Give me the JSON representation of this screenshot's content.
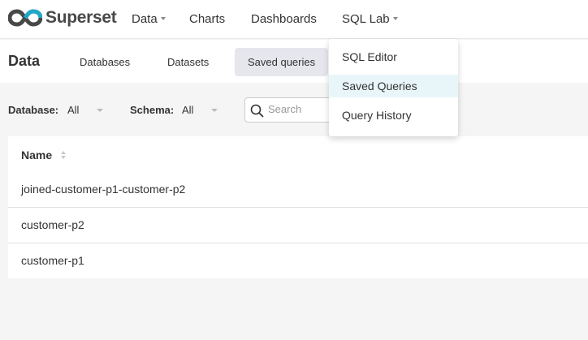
{
  "app": {
    "name": "Superset",
    "brand_colors": {
      "dark": "#484848",
      "teal": "#20a7c9"
    }
  },
  "navbar": {
    "items": [
      {
        "label": "Data",
        "has_caret": true
      },
      {
        "label": "Charts",
        "has_caret": false
      },
      {
        "label": "Dashboards",
        "has_caret": false
      },
      {
        "label": "SQL Lab",
        "has_caret": true
      }
    ]
  },
  "subheader": {
    "title": "Data",
    "tabs": [
      {
        "label": "Databases",
        "active": false
      },
      {
        "label": "Datasets",
        "active": false
      },
      {
        "label": "Saved queries",
        "active": true
      }
    ]
  },
  "filters": {
    "database": {
      "label": "Database:",
      "value": "All"
    },
    "schema": {
      "label": "Schema:",
      "value": "All"
    },
    "search": {
      "placeholder": "Search",
      "icon": "search-icon"
    }
  },
  "table": {
    "columns": [
      {
        "label": "Name",
        "sortable": true
      }
    ],
    "rows": [
      {
        "name": "joined-customer-p1-customer-p2"
      },
      {
        "name": "customer-p2"
      },
      {
        "name": "customer-p1"
      }
    ]
  },
  "sql_lab_menu": {
    "items": [
      {
        "label": "SQL Editor",
        "active": false
      },
      {
        "label": "Saved Queries",
        "active": true
      },
      {
        "label": "Query History",
        "active": false
      }
    ],
    "active_color": "#e9f6f9"
  }
}
